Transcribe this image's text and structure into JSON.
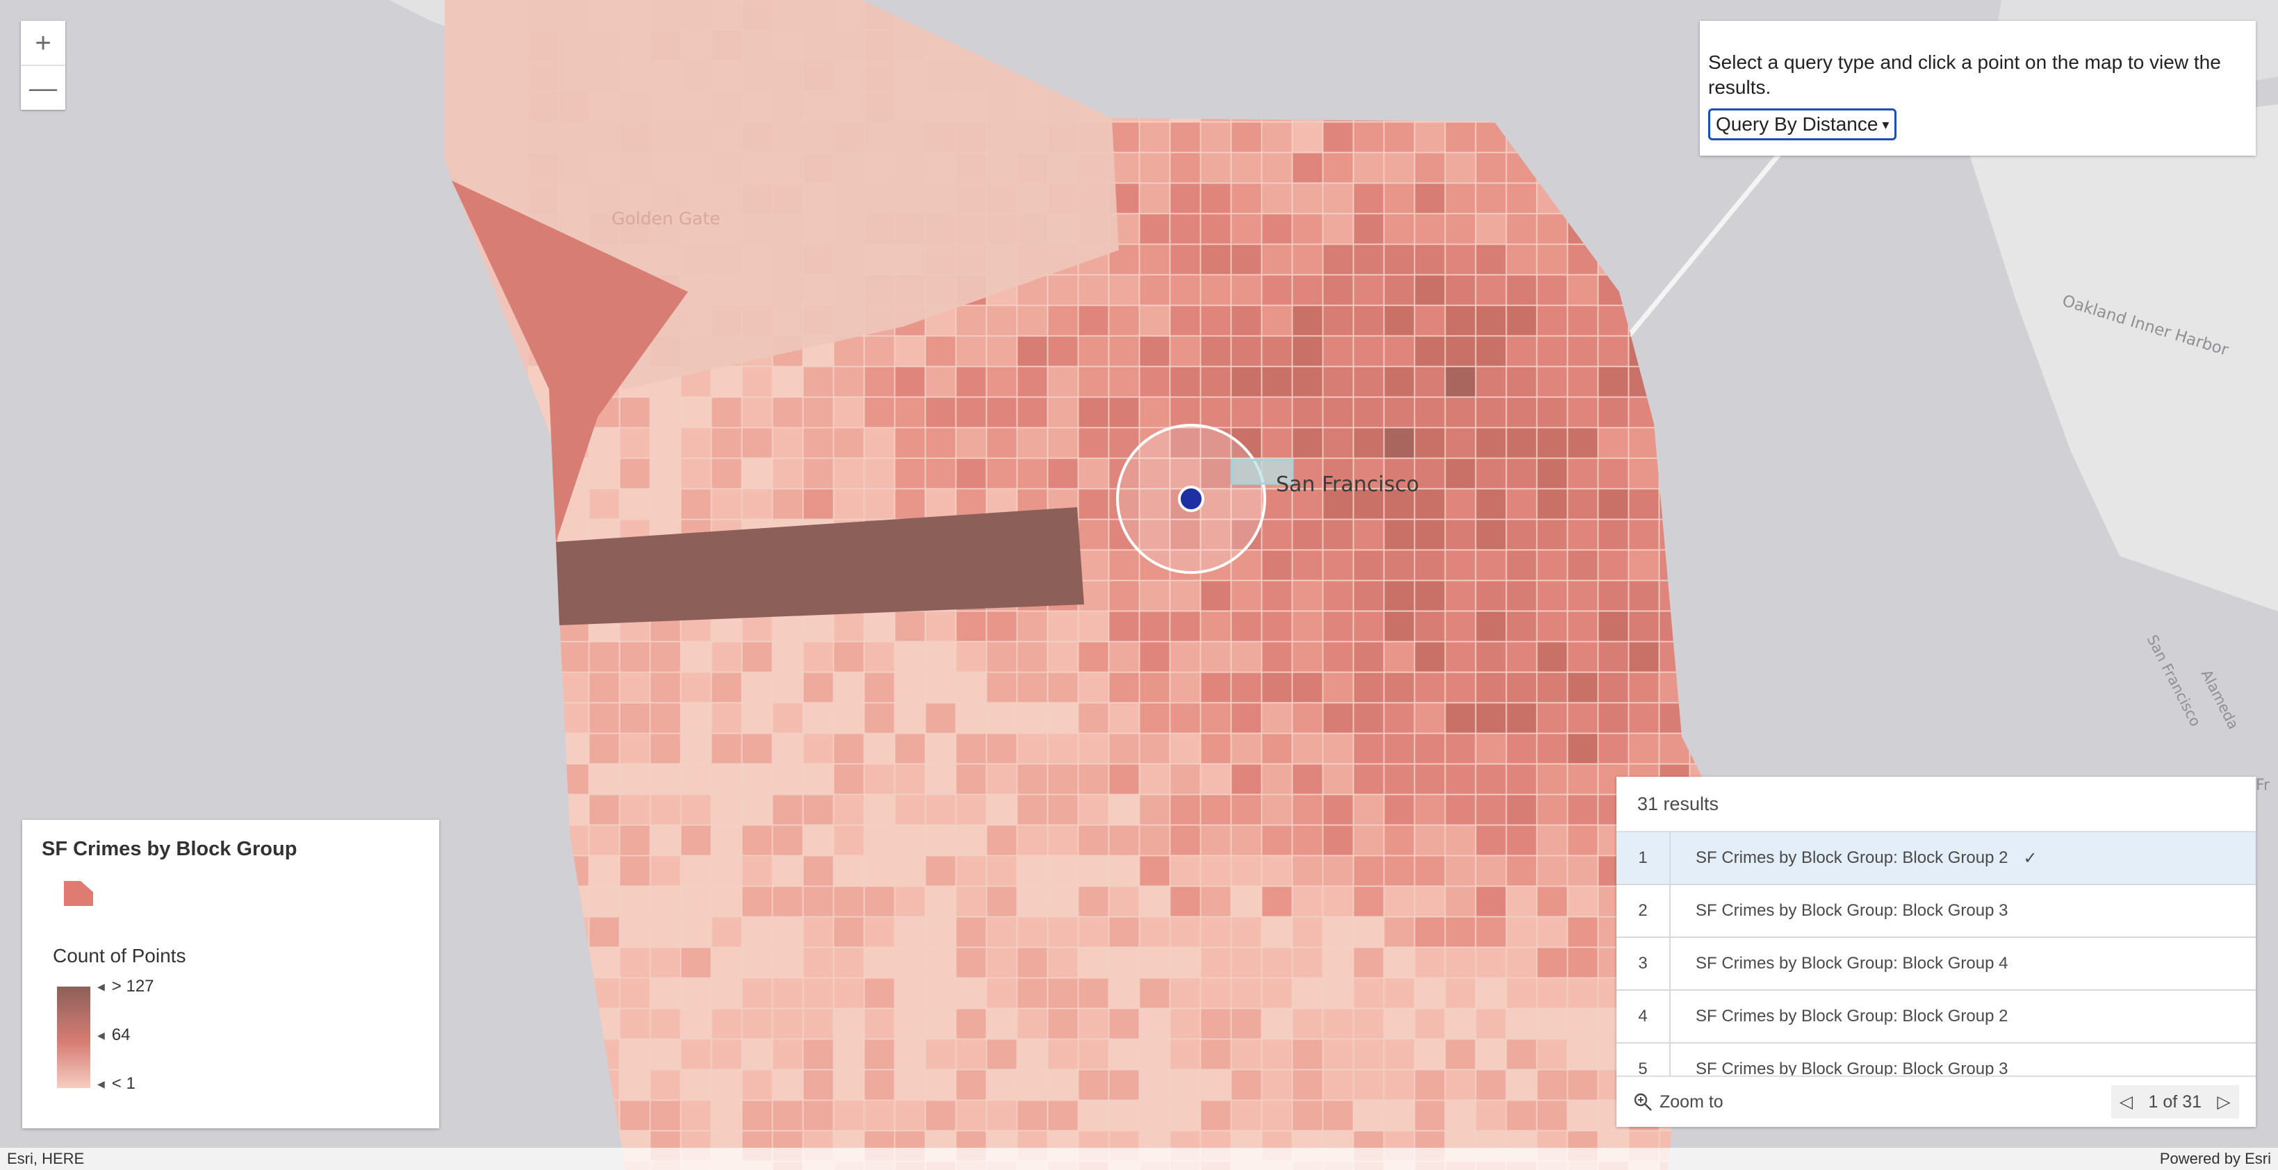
{
  "map": {
    "place_labels": {
      "san_francisco": "San Francisco",
      "golden_gate": "Golden Gate",
      "oakland_inner_harbor": "Oakland Inner Harbor",
      "san_francisco_bay_edge": "San Francisco",
      "alameda": "Alameda",
      "edge_fragment": "Fr"
    },
    "colors": {
      "water": "#d0d0d5",
      "land": "#e6e6e6",
      "class_high": "#8c5f59",
      "class_mid": "#d87d74",
      "class_low": "#f6cdc1",
      "query_point": "#1d2fa3"
    }
  },
  "zoom": {
    "in_label": "+",
    "out_label": "—"
  },
  "query_panel": {
    "instruction": "Select a query type and click a point on the map to view the results.",
    "selected_option": "Query By Distance"
  },
  "legend": {
    "title": "SF Crimes by Block Group",
    "field": "Count of Points",
    "stops": {
      "high": "> 127",
      "mid": "64",
      "low": "< 1"
    }
  },
  "results": {
    "header": "31 results",
    "rows": [
      {
        "num": "1",
        "title": "SF Crimes by Block Group: Block Group 2",
        "selected": true
      },
      {
        "num": "2",
        "title": "SF Crimes by Block Group: Block Group 3",
        "selected": false
      },
      {
        "num": "3",
        "title": "SF Crimes by Block Group: Block Group 4",
        "selected": false
      },
      {
        "num": "4",
        "title": "SF Crimes by Block Group: Block Group 2",
        "selected": false
      },
      {
        "num": "5",
        "title": "SF Crimes by Block Group: Block Group 3",
        "selected": false
      }
    ],
    "zoom_to": "Zoom to",
    "pager": "1 of 31"
  },
  "attribution": {
    "left": "Esri, HERE",
    "right": "Powered by Esri"
  }
}
